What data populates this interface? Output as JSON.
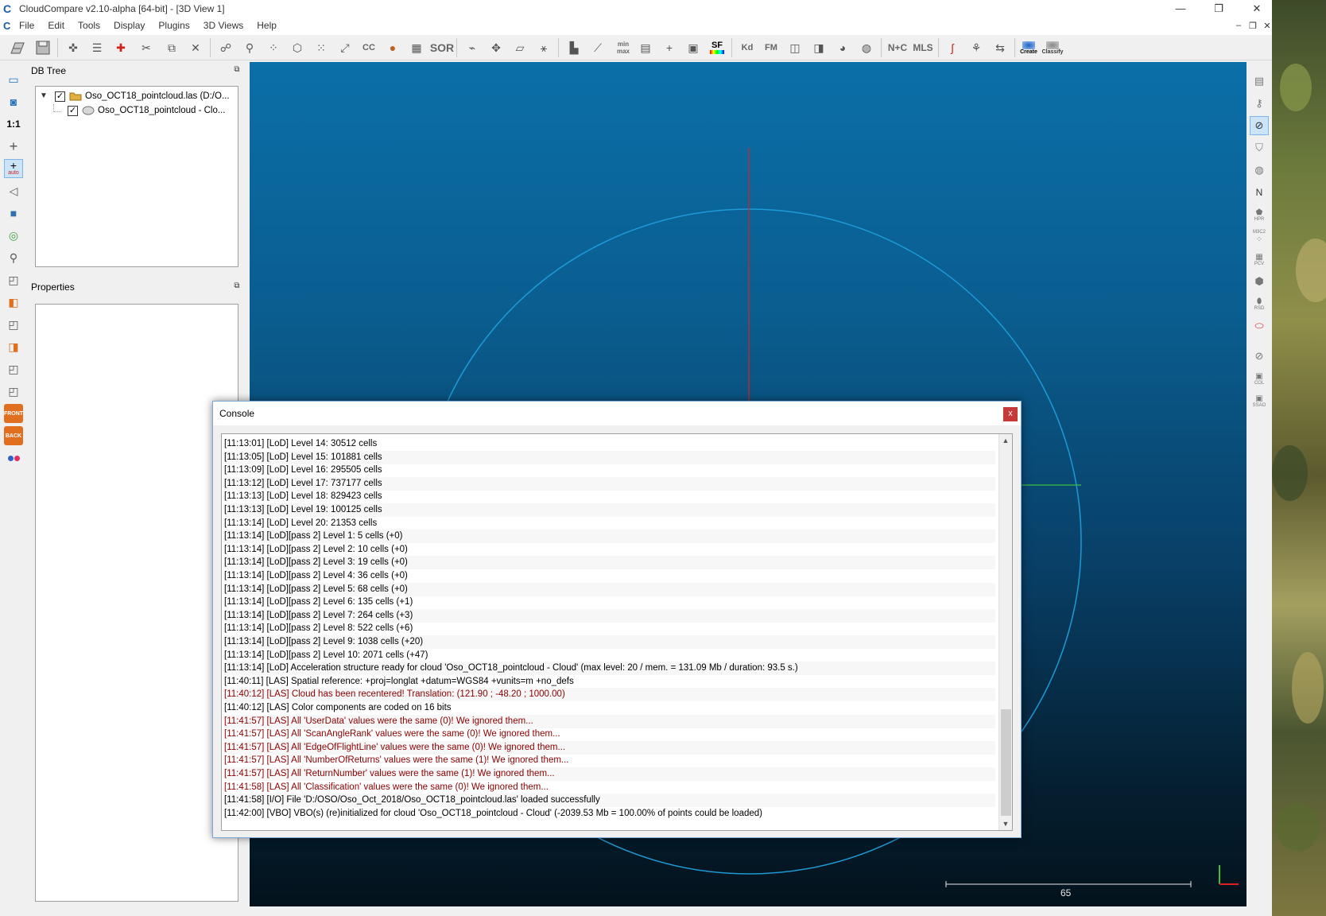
{
  "window": {
    "title": "CloudCompare v2.10-alpha [64-bit] - [3D View 1]",
    "minimize": "—",
    "restore": "❐",
    "close": "✕"
  },
  "menu": {
    "items": [
      "File",
      "Edit",
      "Tools",
      "Display",
      "Plugins",
      "3D Views",
      "Help"
    ],
    "mdi_minimize": "–",
    "mdi_restore": "❐",
    "mdi_close": "✕"
  },
  "toolbar": {
    "sor_label": "SOR",
    "sf_label": "SF",
    "kd_label": "Kd",
    "fm_label": "FM",
    "nc_label": "N+C",
    "mls_label": "MLS",
    "minmax_label": "min max",
    "cc_label": "CC",
    "canupo_create_label": "Create",
    "canupo_classify_label": "Classify"
  },
  "left_toolbar": {
    "one_to_one_label": "1:1",
    "auto_label": "auto",
    "front_label": "FRONT",
    "back_label": "BACK"
  },
  "right_toolbar": {
    "n_label": "N",
    "hpr_label": "HPR",
    "m3c2_label": "M3C2",
    "pcv_label": "PCV",
    "rsd_label": "RSD",
    "col_label": "COL",
    "ssao_label": "SSAO"
  },
  "db_tree": {
    "title": "DB Tree",
    "items": [
      {
        "label": "Oso_OCT18_pointcloud.las (D:/O...",
        "checked": "✓"
      },
      {
        "label": "Oso_OCT18_pointcloud - Clo...",
        "checked": "✓"
      }
    ]
  },
  "properties": {
    "title": "Properties"
  },
  "view3d": {
    "scale_value": "65"
  },
  "console": {
    "title": "Console",
    "close_label": "x",
    "lines": [
      {
        "text": "[11:13:01] [LoD] Level 14: 30512 cells",
        "warn": false
      },
      {
        "text": "[11:13:05] [LoD] Level 15: 101881 cells",
        "warn": false
      },
      {
        "text": "[11:13:09] [LoD] Level 16: 295505 cells",
        "warn": false
      },
      {
        "text": "[11:13:12] [LoD] Level 17: 737177 cells",
        "warn": false
      },
      {
        "text": "[11:13:13] [LoD] Level 18: 829423 cells",
        "warn": false
      },
      {
        "text": "[11:13:13] [LoD] Level 19: 100125 cells",
        "warn": false
      },
      {
        "text": "[11:13:14] [LoD] Level 20: 21353 cells",
        "warn": false
      },
      {
        "text": "[11:13:14] [LoD][pass 2] Level 1: 5 cells (+0)",
        "warn": false
      },
      {
        "text": "[11:13:14] [LoD][pass 2] Level 2: 10 cells (+0)",
        "warn": false
      },
      {
        "text": "[11:13:14] [LoD][pass 2] Level 3: 19 cells (+0)",
        "warn": false
      },
      {
        "text": "[11:13:14] [LoD][pass 2] Level 4: 36 cells (+0)",
        "warn": false
      },
      {
        "text": "[11:13:14] [LoD][pass 2] Level 5: 68 cells (+0)",
        "warn": false
      },
      {
        "text": "[11:13:14] [LoD][pass 2] Level 6: 135 cells (+1)",
        "warn": false
      },
      {
        "text": "[11:13:14] [LoD][pass 2] Level 7: 264 cells (+3)",
        "warn": false
      },
      {
        "text": "[11:13:14] [LoD][pass 2] Level 8: 522 cells (+6)",
        "warn": false
      },
      {
        "text": "[11:13:14] [LoD][pass 2] Level 9: 1038 cells (+20)",
        "warn": false
      },
      {
        "text": "[11:13:14] [LoD][pass 2] Level 10: 2071 cells (+47)",
        "warn": false
      },
      {
        "text": "[11:13:14] [LoD] Acceleration structure ready for cloud 'Oso_OCT18_pointcloud - Cloud' (max level: 20 / mem. = 131.09 Mb / duration: 93.5 s.)",
        "warn": false
      },
      {
        "text": "[11:40:11] [LAS] Spatial reference: +proj=longlat +datum=WGS84 +vunits=m +no_defs",
        "warn": false
      },
      {
        "text": "[11:40:12] [LAS] Cloud has been recentered! Translation: (121.90 ; -48.20 ; 1000.00)",
        "warn": true
      },
      {
        "text": "[11:40:12] [LAS] Color components are coded on 16 bits",
        "warn": false
      },
      {
        "text": "[11:41:57] [LAS] All 'UserData' values were the same (0)! We ignored them...",
        "warn": true
      },
      {
        "text": "[11:41:57] [LAS] All 'ScanAngleRank' values were the same (0)! We ignored them...",
        "warn": true
      },
      {
        "text": "[11:41:57] [LAS] All 'EdgeOfFlightLine' values were the same (0)! We ignored them...",
        "warn": true
      },
      {
        "text": "[11:41:57] [LAS] All 'NumberOfReturns' values were the same (1)! We ignored them...",
        "warn": true
      },
      {
        "text": "[11:41:57] [LAS] All 'ReturnNumber' values were the same (1)! We ignored them...",
        "warn": true
      },
      {
        "text": "[11:41:58] [LAS] All 'Classification' values were the same (0)! We ignored them...",
        "warn": true
      },
      {
        "text": "[11:41:58] [I/O] File 'D:/OSO/Oso_Oct_2018/Oso_OCT18_pointcloud.las' loaded successfully",
        "warn": false
      },
      {
        "text": "[11:42:00] [VBO] VBO(s) (re)initialized for cloud 'Oso_OCT18_pointcloud - Cloud' (-2039.53 Mb = 100.00% of points could be loaded)",
        "warn": false
      }
    ],
    "scroll_up": "▲",
    "scroll_down": "▼"
  },
  "colors": {
    "warn_text": "#8b0000",
    "view_top": "#0b6fa8",
    "view_bottom": "#03121c",
    "circle": "#1e9ad6",
    "axis_x": "#e02020",
    "axis_y": "#3cc03c"
  }
}
